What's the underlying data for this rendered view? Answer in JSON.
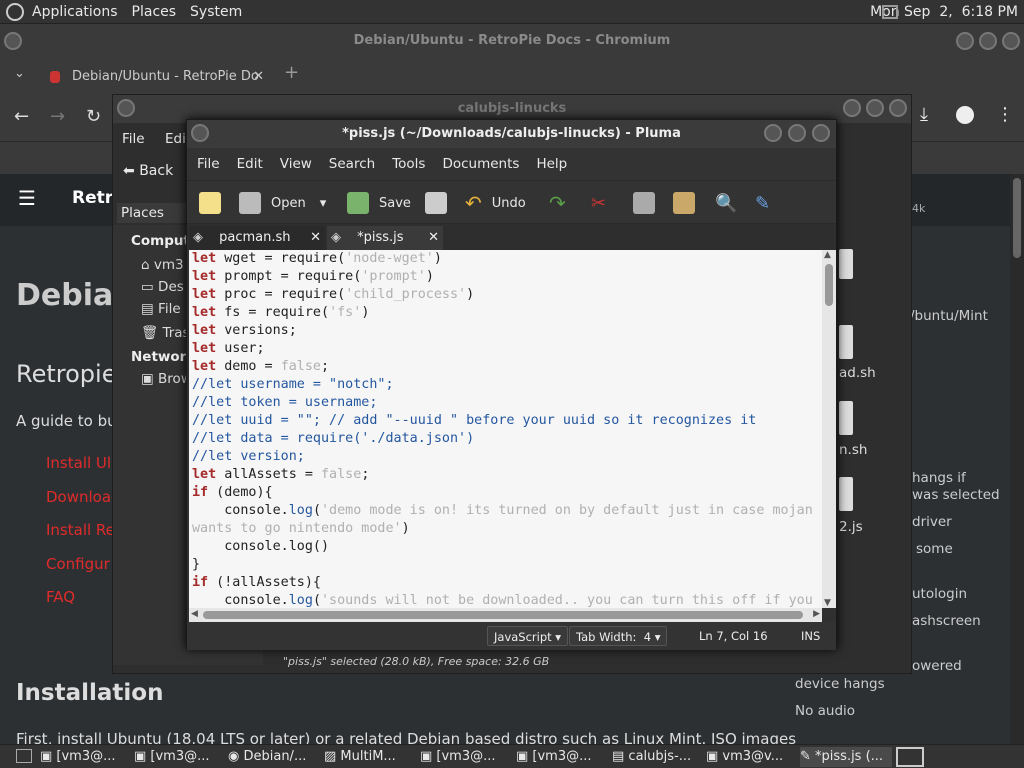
{
  "top_panel": {
    "menus": [
      "Applications",
      "Places",
      "System"
    ],
    "clock": "Mon Sep  2,  6:18 PM"
  },
  "chromium": {
    "title": "Debian/Ubuntu - RetroPie Docs - Chromium",
    "tab_label": "Debian/Ubuntu - RetroPie Do",
    "page": {
      "heading_partial": "Debian",
      "subheading_partial": "Retropie",
      "intro_partial": "A guide to bu",
      "links": [
        "Install Ul",
        "Download",
        "Install Re",
        "Configur",
        "FAQ"
      ],
      "site_title_partial": "Retro",
      "installation_heading": "Installation",
      "installation_text": "First, install Ubuntu (18.04 LTS or later) or a related Debian based distro such as Linux Mint. ISO images",
      "right_items": [
        "4k",
        "/buntu/Mint",
        "hangs if",
        "was selected",
        "driver",
        "some",
        "utologin",
        "ashscreen",
        "owered",
        "device hangs",
        "No audio"
      ]
    }
  },
  "files_window": {
    "title": "calubjs-linucks",
    "menu": [
      "File",
      "Edit"
    ],
    "back_label": "Back",
    "places_label": "Places",
    "sections": [
      {
        "header": "Compute",
        "items": [
          "vm3",
          "Des",
          "File",
          "Tras"
        ]
      },
      {
        "header": "Network",
        "items": [
          "Brow"
        ]
      }
    ],
    "files": [
      "ad.sh",
      "n.sh",
      "2.js"
    ],
    "status": "\"piss.js\" selected (28.0 kB), Free space: 32.6 GB"
  },
  "pluma": {
    "title": "*piss.js (~/Downloads/calubjs-linucks) - Pluma",
    "menu": [
      "File",
      "Edit",
      "View",
      "Search",
      "Tools",
      "Documents",
      "Help"
    ],
    "toolbar": {
      "open": "Open",
      "save": "Save",
      "undo": "Undo"
    },
    "tabs": [
      {
        "label": "pacman.sh",
        "close": "✕"
      },
      {
        "label": "*piss.js",
        "close": "✕"
      }
    ],
    "code_lines": [
      [
        {
          "t": "let",
          "c": "kw"
        },
        {
          "t": " wget = require("
        },
        {
          "t": "'node-wget'",
          "c": "str"
        },
        {
          "t": ")"
        }
      ],
      [
        {
          "t": "let",
          "c": "kw"
        },
        {
          "t": " prompt = require("
        },
        {
          "t": "'prompt'",
          "c": "str"
        },
        {
          "t": ")"
        }
      ],
      [
        {
          "t": "let",
          "c": "kw"
        },
        {
          "t": " proc = require("
        },
        {
          "t": "'child_process'",
          "c": "str"
        },
        {
          "t": ")"
        }
      ],
      [
        {
          "t": "let",
          "c": "kw"
        },
        {
          "t": " fs = require("
        },
        {
          "t": "'fs'",
          "c": "str"
        },
        {
          "t": ")"
        }
      ],
      [
        {
          "t": "let",
          "c": "kw"
        },
        {
          "t": " versions;"
        }
      ],
      [
        {
          "t": "let",
          "c": "kw"
        },
        {
          "t": " user;"
        }
      ],
      [
        {
          "t": "let",
          "c": "kw"
        },
        {
          "t": " demo = "
        },
        {
          "t": "false",
          "c": "str"
        },
        {
          "t": ";"
        }
      ],
      [
        {
          "t": "//let username = \"notch\";",
          "c": "cm"
        }
      ],
      [
        {
          "t": "//let token = username;",
          "c": "cm"
        }
      ],
      [
        {
          "t": "//let uuid = \"\"; // add \"--uuid \" before your uuid so it recognizes it",
          "c": "cm"
        }
      ],
      [
        {
          "t": "//let data = require('./data.json')",
          "c": "cm"
        }
      ],
      [
        {
          "t": "//let version;",
          "c": "cm"
        }
      ],
      [
        {
          "t": "let",
          "c": "kw"
        },
        {
          "t": " allAssets = "
        },
        {
          "t": "false",
          "c": "str"
        },
        {
          "t": ";"
        }
      ],
      [
        {
          "t": "if",
          "c": "kw"
        },
        {
          "t": " (demo){"
        }
      ],
      [
        {
          "t": "    console."
        },
        {
          "t": "log",
          "c": "cm"
        },
        {
          "t": "("
        },
        {
          "t": "'demo mode is on! its turned on by default just in case mojan",
          "c": "str"
        }
      ],
      [
        {
          "t": "wants to go nintendo mode'",
          "c": "str"
        },
        {
          "t": ")"
        }
      ],
      [
        {
          "t": "    console.log()"
        }
      ],
      [
        {
          "t": "}"
        }
      ],
      [
        {
          "t": "if",
          "c": "kw"
        },
        {
          "t": " (!allAssets){"
        }
      ],
      [
        {
          "t": "    console."
        },
        {
          "t": "log",
          "c": "cm"
        },
        {
          "t": "("
        },
        {
          "t": "'sounds will not be downloaded.. you can turn this off if you",
          "c": "str"
        }
      ]
    ],
    "status": {
      "language": "JavaScript",
      "tab_width": "Tab Width:  4",
      "position": "Ln 7, Col 16",
      "mode": "INS"
    }
  },
  "taskbar": {
    "items": [
      "[vm3@...",
      "[vm3@...",
      "Debian/...",
      "MultiM...",
      "[vm3@...",
      "[vm3@...",
      "calubjs-...",
      "vm3@v...",
      "*piss.js (..."
    ]
  }
}
